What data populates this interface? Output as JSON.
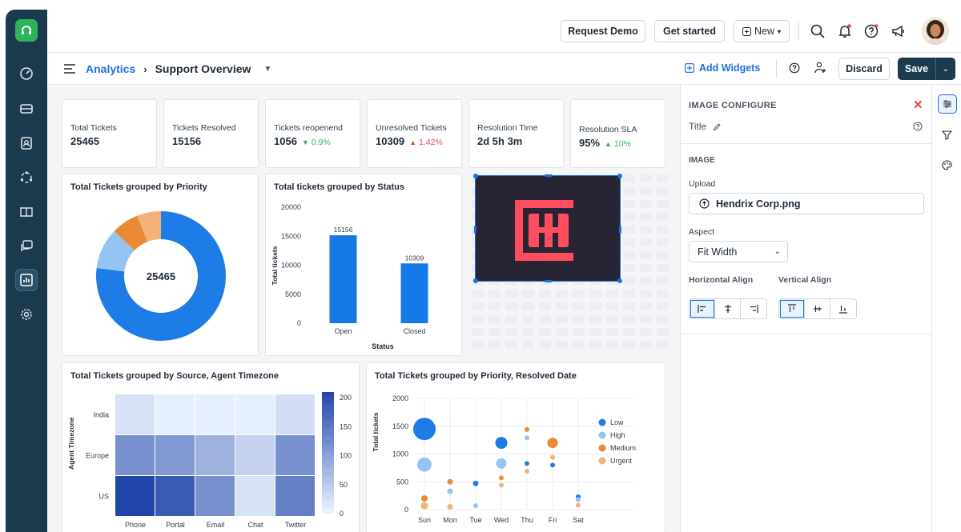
{
  "topbar": {
    "request_demo": "Request Demo",
    "get_started": "Get started",
    "new_label": "New"
  },
  "breadcrumb": {
    "root": "Analytics",
    "current": "Support Overview"
  },
  "actions": {
    "add_widgets": "Add Widgets",
    "discard": "Discard",
    "save": "Save"
  },
  "kpis": [
    {
      "label": "Total Tickets",
      "value": "25465",
      "change": ""
    },
    {
      "label": "Tickets Resolved",
      "value": "15156",
      "change": ""
    },
    {
      "label": "Tickets reopenend",
      "value": "1056",
      "change": "0.9%"
    },
    {
      "label": "Unresolved Tickets",
      "value": "10309",
      "change": "1.42%"
    },
    {
      "label": "Resolution Time",
      "value": "2d 5h 3m",
      "change": ""
    },
    {
      "label": "Resolution SLA",
      "value": "95%",
      "change": "10%"
    }
  ],
  "colors": {
    "accent": "#1f6fe0",
    "good": "#2fb35a",
    "bad": "#e5484d",
    "rail": "#1b3a4e"
  },
  "chart_data": [
    {
      "type": "pie",
      "title": "Total Tickets grouped by Priority",
      "center_label": "25465",
      "slices": [
        {
          "name": "Low",
          "value": 19600,
          "color": "#1e7ce6"
        },
        {
          "name": "High",
          "value": 2600,
          "color": "#95c4f4"
        },
        {
          "name": "Medium",
          "value": 1750,
          "color": "#ea8a35"
        },
        {
          "name": "Urgent",
          "value": 1515,
          "color": "#f3b27a"
        }
      ]
    },
    {
      "type": "bar",
      "title": "Total tickets grouped by Status",
      "categories": [
        "Open",
        "Closed"
      ],
      "values": [
        15156,
        10309
      ],
      "xlabel": "Status",
      "ylabel": "Total tickets",
      "ylim": [
        0,
        20000
      ],
      "yticks": [
        0,
        5000,
        10000,
        15000,
        20000
      ]
    },
    {
      "type": "heatmap",
      "title": "Total Tickets grouped by Source, Agent Timezone",
      "x": [
        "Phone",
        "Portal",
        "Email",
        "Chat",
        "Twitter"
      ],
      "y": [
        "India",
        "Europe",
        "US"
      ],
      "ylabel": "Agent Timezone",
      "values": [
        [
          20,
          5,
          5,
          5,
          25
        ],
        [
          120,
          110,
          80,
          40,
          120
        ],
        [
          210,
          185,
          120,
          20,
          140
        ]
      ],
      "scale_ticks": [
        200,
        150,
        100,
        50,
        0
      ]
    },
    {
      "type": "scatter",
      "title": "Total Tickets grouped by Priority, Resolved Date",
      "x": [
        "Sun",
        "Mon",
        "Tue",
        "Wed",
        "Thu",
        "Fri",
        "Sat"
      ],
      "ylabel": "Total tickets",
      "ylim": [
        0,
        2000
      ],
      "yticks": [
        0,
        500,
        1000,
        1500,
        2000
      ],
      "series": [
        {
          "name": "Low",
          "color": "#1e7ce6",
          "points": [
            [
              "Sun",
              1450,
              14
            ],
            [
              "Tue",
              470,
              3.5
            ],
            [
              "Wed",
              1200,
              7.5
            ],
            [
              "Thu",
              830,
              3
            ],
            [
              "Fri",
              800,
              3
            ],
            [
              "Sat",
              230,
              3
            ]
          ]
        },
        {
          "name": "High",
          "color": "#95c4f4",
          "points": [
            [
              "Sun",
              810,
              9
            ],
            [
              "Mon",
              330,
              3.5
            ],
            [
              "Tue",
              70,
              3
            ],
            [
              "Wed",
              830,
              6.5
            ],
            [
              "Thu",
              1290,
              3
            ],
            [
              "Sat",
              180,
              3
            ]
          ]
        },
        {
          "name": "Medium",
          "color": "#ea8a35",
          "points": [
            [
              "Sun",
              200,
              4
            ],
            [
              "Mon",
              500,
              3.5
            ],
            [
              "Wed",
              570,
              3
            ],
            [
              "Thu",
              1440,
              3
            ],
            [
              "Fri",
              1200,
              6.5
            ]
          ]
        },
        {
          "name": "Urgent",
          "color": "#f3b27a",
          "points": [
            [
              "Sun",
              70,
              4.5
            ],
            [
              "Mon",
              50,
              3.5
            ],
            [
              "Wed",
              440,
              3
            ],
            [
              "Thu",
              690,
              3
            ],
            [
              "Fri",
              940,
              3
            ],
            [
              "Sat",
              80,
              3
            ]
          ]
        }
      ]
    }
  ],
  "panel": {
    "heading": "IMAGE CONFIGURE",
    "title_label": "Title",
    "section": "IMAGE",
    "upload_label": "Upload",
    "upload_file": "Hendrix Corp.png",
    "aspect_label": "Aspect",
    "aspect_value": "Fit Width",
    "halign_label": "Horizontal Align",
    "valign_label": "Vertical Align",
    "halign_selected": "left",
    "valign_selected": "top"
  }
}
